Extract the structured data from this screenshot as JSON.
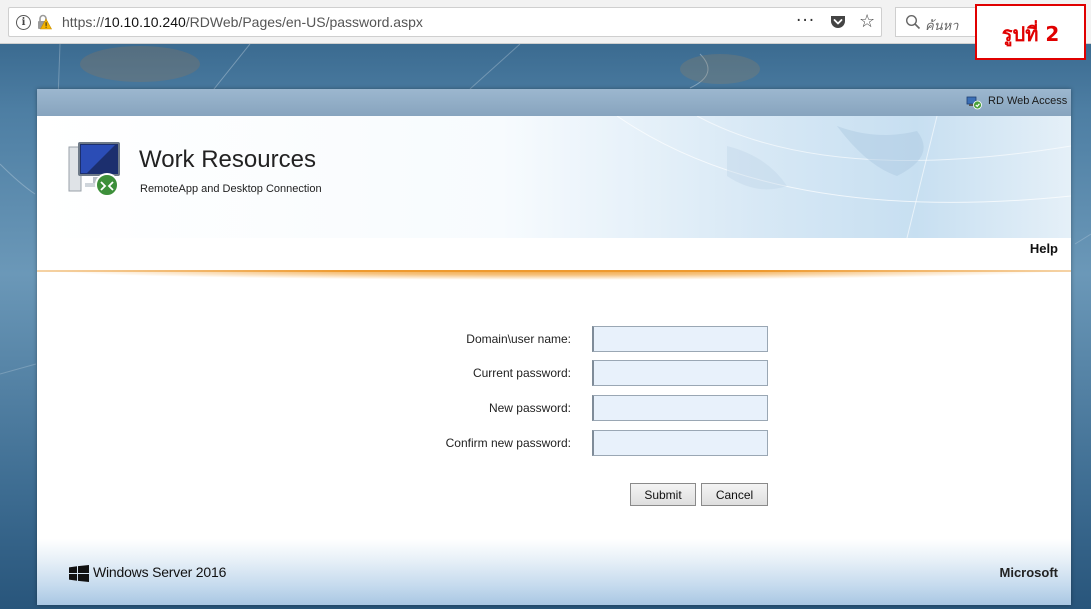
{
  "browser": {
    "url_prefix": "https://",
    "url_host": "10.10.10.240",
    "url_path": "/RDWeb/Pages/en-US/password.aspx",
    "more_label": "···",
    "search_placeholder": "ค้นหา"
  },
  "badge": {
    "label": "รูปที่ 2"
  },
  "header": {
    "rd_web_access_label": "RD Web Access",
    "title": "Work Resources",
    "subtitle": "RemoteApp and Desktop Connection",
    "help_label": "Help"
  },
  "form": {
    "fields": [
      {
        "label": "Domain\\user name:",
        "value": ""
      },
      {
        "label": "Current password:",
        "value": ""
      },
      {
        "label": "New password:",
        "value": ""
      },
      {
        "label": "Confirm new password:",
        "value": ""
      }
    ],
    "submit_label": "Submit",
    "cancel_label": "Cancel"
  },
  "footer": {
    "product_label": "Windows Server 2016",
    "company_label": "Microsoft"
  },
  "colors": {
    "accent_orange": "#ee9a2f",
    "badge_red": "#e00000",
    "input_bg": "#e8f1fb"
  },
  "icons": [
    "info-icon",
    "lock-warning-icon",
    "pocket-icon",
    "star-icon",
    "search-icon",
    "rd-web-access-icon",
    "remote-desktop-monitor-icon",
    "windows-logo-icon"
  ]
}
